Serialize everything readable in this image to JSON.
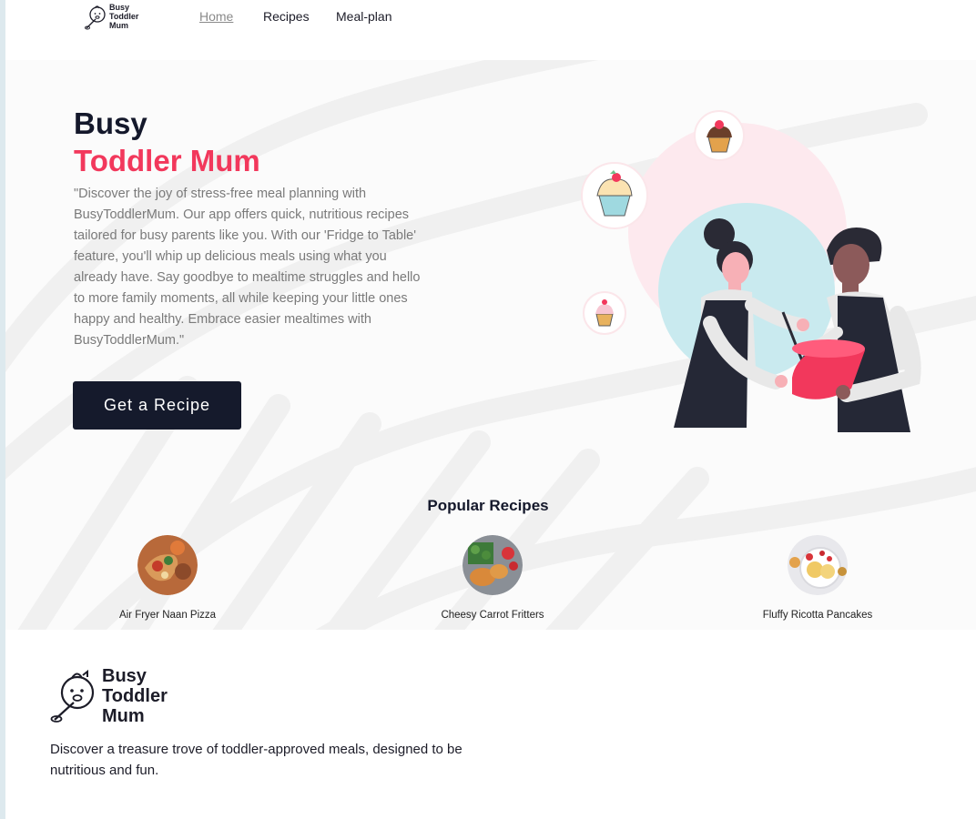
{
  "nav": {
    "logo_text": "Busy Toddler Mum",
    "links": [
      "Home",
      "Recipes",
      "Meal-plan"
    ]
  },
  "hero": {
    "title_line1": "Busy",
    "title_line2": "Toddler Mum",
    "description": "\"Discover the joy of stress-free meal planning with BusyToddlerMum. Our app offers quick, nutritious recipes tailored for busy parents like you. With our 'Fridge to Table' feature, you'll whip up delicious meals using what you already have. Say goodbye to mealtime struggles and hello to more family moments, all while keeping your little ones happy and healthy. Embrace easier mealtimes with BusyToddlerMum.\"",
    "cta_label": "Get a Recipe"
  },
  "popular": {
    "title": "Popular Recipes",
    "recipes": [
      {
        "name": "Air Fryer Naan Pizza"
      },
      {
        "name": "Cheesy Carrot Fritters"
      },
      {
        "name": "Fluffy Ricotta Pancakes"
      }
    ]
  },
  "footer": {
    "logo_text": "Busy Toddler Mum",
    "tagline": "Discover a treasure trove of toddler-approved meals, designed to be nutritious and fun."
  },
  "colors": {
    "accent": "#f2385c",
    "dark": "#151a2c",
    "muted_text": "#7a7a7a"
  }
}
